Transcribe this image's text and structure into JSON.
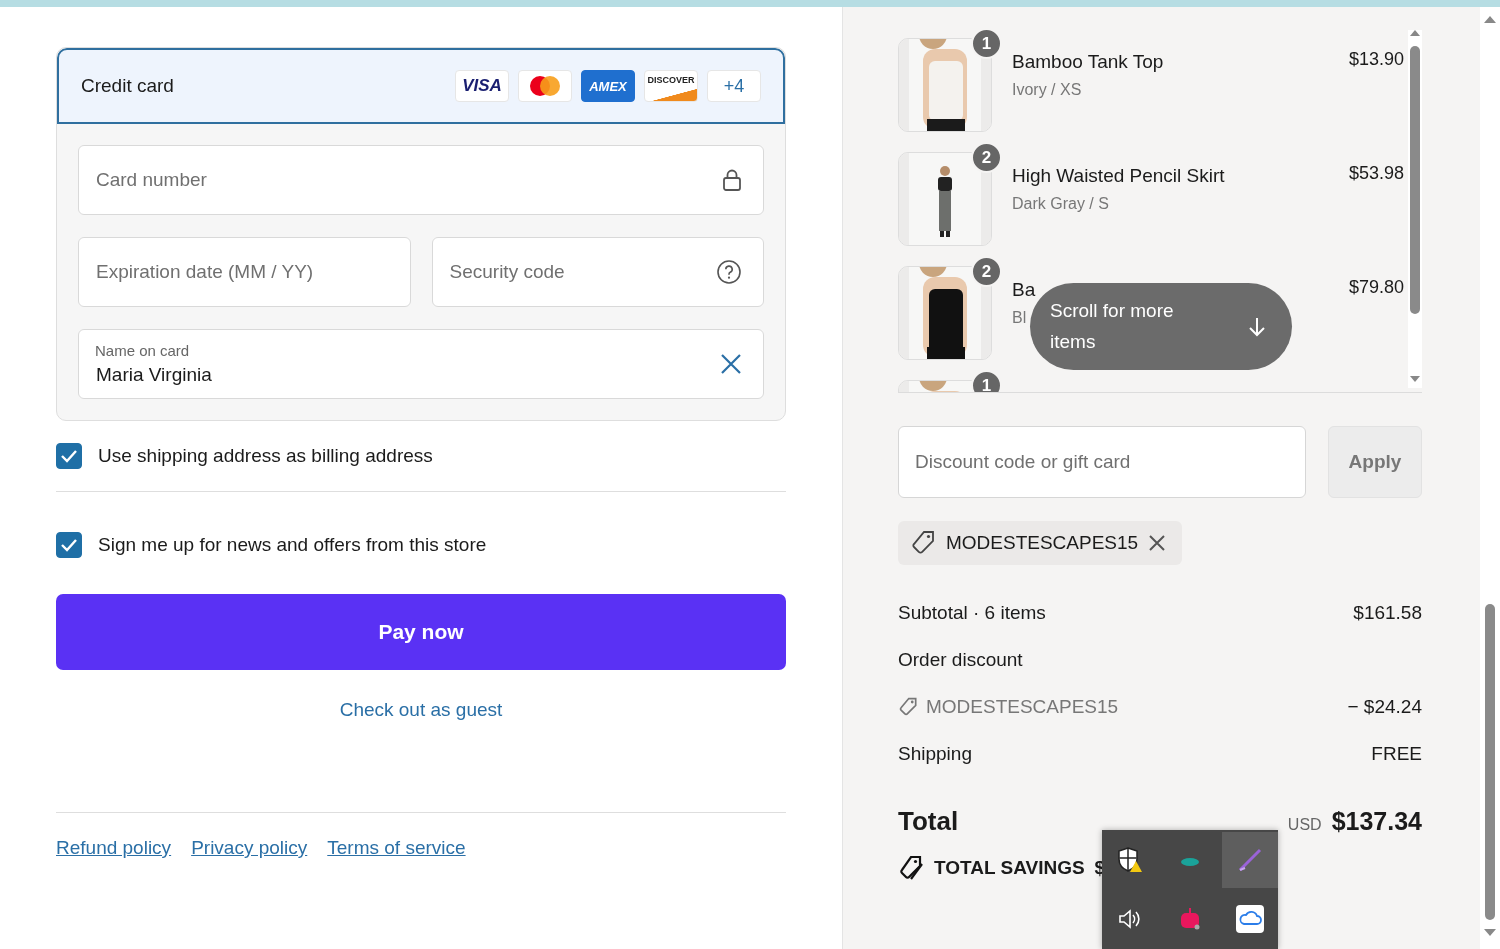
{
  "payment_method": {
    "label": "Credit card",
    "selected": true,
    "brands": [
      {
        "kind": "visa",
        "label": "VISA"
      },
      {
        "kind": "mastercard"
      },
      {
        "kind": "amex",
        "label": "AMEX"
      },
      {
        "kind": "discover",
        "label": "DISCOVER"
      },
      {
        "kind": "more",
        "label": "+4"
      }
    ]
  },
  "field_rows": [
    [
      {
        "kind": "card_number",
        "placeholder": "Card number"
      }
    ],
    [
      {
        "kind": "expiry",
        "placeholder": "Expiration date (MM / YY)"
      },
      {
        "kind": "security_code",
        "placeholder": "Security code"
      }
    ],
    [
      {
        "kind": "name",
        "label": "Name on card",
        "value": "Maria Virginia"
      }
    ]
  ],
  "options": [
    {
      "label": "Use shipping address as billing address",
      "checked": true
    },
    {
      "label": "Sign me up for news and offers from this store",
      "checked": true
    }
  ],
  "pay_button": "Pay now",
  "guest_link": "Check out as guest",
  "footer_links": [
    "Refund policy",
    "Privacy policy",
    "Terms of service"
  ],
  "order_items": [
    {
      "quantity": "1",
      "name": "Bamboo Tank Top",
      "variant": "Ivory / XS",
      "price": "$13.90"
    },
    {
      "quantity": "2",
      "name": "High Waisted Pencil Skirt",
      "variant": "Dark Gray / S",
      "price": "$53.98"
    },
    {
      "quantity": "2",
      "name": "Ba",
      "variant": "Bl",
      "price": "$79.80"
    },
    {
      "quantity": "1"
    }
  ],
  "scroll_hint": "Scroll for more items",
  "discount": {
    "placeholder": "Discount code or gift card",
    "button": "Apply"
  },
  "applied_code": "MODESTESCAPES15",
  "summary": {
    "subtotal_label": "Subtotal · 6 items",
    "subtotal": "$161.58",
    "discount_label": "Order discount",
    "discount_code": "MODESTESCAPES15",
    "discount_amount": "− $24.24",
    "shipping_label": "Shipping",
    "shipping": "FREE",
    "total_label": "Total",
    "currency": "USD",
    "total": "$137.34",
    "savings_label": "TOTAL SAVINGS",
    "savings_value": "$"
  }
}
